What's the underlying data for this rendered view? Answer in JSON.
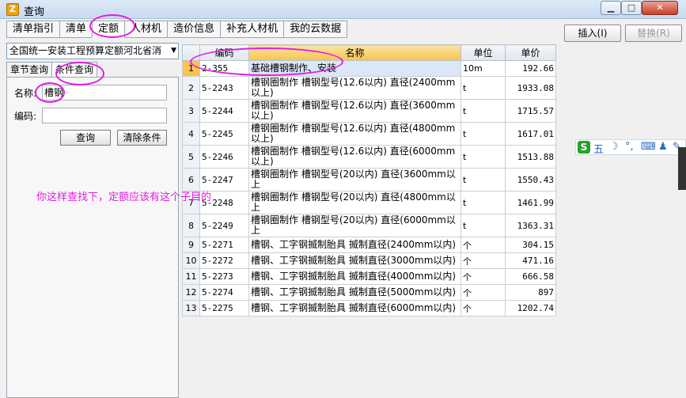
{
  "window": {
    "title": "查询",
    "min_glyph": "▁",
    "max_glyph": "□",
    "close_glyph": "✕"
  },
  "top_tabs": [
    "清单指引",
    "清单",
    "定额",
    "人材机",
    "造价信息",
    "补充人材机",
    "我的云数据"
  ],
  "toolbar": {
    "insert_label": "插入(I)",
    "replace_label": "替换(R)"
  },
  "left": {
    "dropdown_value": "全国统一安装工程预算定额河北省消",
    "sub_tabs": [
      "章节查询",
      "条件查询"
    ],
    "name_label": "名称:",
    "name_value": "槽钢",
    "code_label": "编码:",
    "code_value": "",
    "query_button": "查询",
    "clear_button": "清除条件"
  },
  "grid": {
    "headers": [
      "编码",
      "名称",
      "单位",
      "单价"
    ],
    "rows": [
      {
        "n": "1",
        "code": "2-355",
        "name": "基础槽钢制作、安装",
        "unit": "10m",
        "price": "192.66"
      },
      {
        "n": "2",
        "code": "5-2243",
        "name": "槽钢圈制作 槽钢型号(12.6以内) 直径(2400mm以上)",
        "unit": "t",
        "price": "1933.08"
      },
      {
        "n": "3",
        "code": "5-2244",
        "name": "槽钢圈制作 槽钢型号(12.6以内) 直径(3600mm以上)",
        "unit": "t",
        "price": "1715.57"
      },
      {
        "n": "4",
        "code": "5-2245",
        "name": "槽钢圈制作 槽钢型号(12.6以内) 直径(4800mm以上)",
        "unit": "t",
        "price": "1617.01"
      },
      {
        "n": "5",
        "code": "5-2246",
        "name": "槽钢圈制作 槽钢型号(12.6以内) 直径(6000mm以上)",
        "unit": "t",
        "price": "1513.88"
      },
      {
        "n": "6",
        "code": "5-2247",
        "name": "槽钢圈制作 槽钢型号(20以内) 直径(3600mm以上",
        "unit": "t",
        "price": "1550.43"
      },
      {
        "n": "7",
        "code": "5-2248",
        "name": "槽钢圈制作 槽钢型号(20以内) 直径(4800mm以上",
        "unit": "t",
        "price": "1461.99"
      },
      {
        "n": "8",
        "code": "5-2249",
        "name": "槽钢圈制作 槽钢型号(20以内) 直径(6000mm以上",
        "unit": "t",
        "price": "1363.31"
      },
      {
        "n": "9",
        "code": "5-2271",
        "name": "槽钢、工字钢揻制胎具 揻制直径(2400mm以内)",
        "unit": "个",
        "price": "304.15"
      },
      {
        "n": "10",
        "code": "5-2272",
        "name": "槽钢、工字钢揻制胎具 揻制直径(3000mm以内)",
        "unit": "个",
        "price": "471.16"
      },
      {
        "n": "11",
        "code": "5-2273",
        "name": "槽钢、工字钢揻制胎具 揻制直径(4000mm以内)",
        "unit": "个",
        "price": "666.58"
      },
      {
        "n": "12",
        "code": "5-2274",
        "name": "槽钢、工字钢揻制胎具 揻制直径(5000mm以内)",
        "unit": "个",
        "price": "897"
      },
      {
        "n": "13",
        "code": "5-2275",
        "name": "槽钢、工字钢揻制胎具 揻制直径(6000mm以内)",
        "unit": "个",
        "price": "1202.74"
      }
    ]
  },
  "annotation_text": "你这样查找下，定额应该有这个子目的",
  "ime": {
    "logo": "S",
    "items": [
      "五",
      "☽",
      "°,",
      "⌨",
      "♟",
      "✎"
    ]
  },
  "colors": {
    "annotation": "#e11ee0",
    "header_highlight": "#f6c44f"
  }
}
